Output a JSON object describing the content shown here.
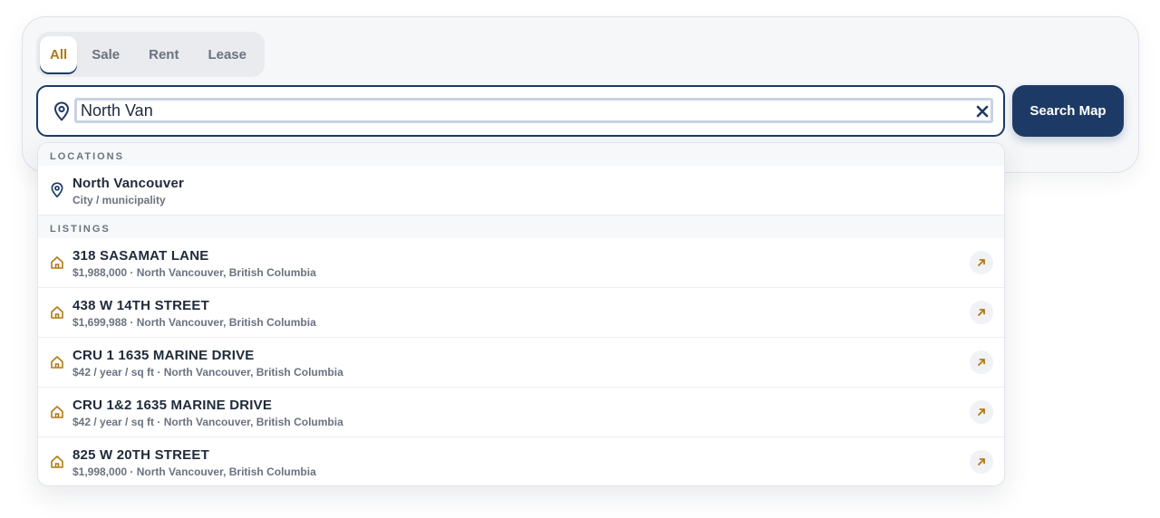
{
  "tabs": [
    {
      "label": "All",
      "active": true
    },
    {
      "label": "Sale",
      "active": false
    },
    {
      "label": "Rent",
      "active": false
    },
    {
      "label": "Lease",
      "active": false
    }
  ],
  "search": {
    "value": "North Van",
    "icon": "location-pin-icon",
    "clear_icon": "close-icon"
  },
  "search_map_button": {
    "label": "Search Map"
  },
  "dropdown": {
    "locations_header": "LOCATIONS",
    "locations": [
      {
        "title": "North Vancouver",
        "subtitle": "City / municipality",
        "icon": "location-pin-icon"
      }
    ],
    "listings_header": "LISTINGS",
    "listings": [
      {
        "title": "318 SASAMAT LANE",
        "subtitle": "$1,988,000 · North Vancouver, British Columbia",
        "icon": "home-icon"
      },
      {
        "title": "438 W 14TH STREET",
        "subtitle": "$1,699,988 · North Vancouver, British Columbia",
        "icon": "home-icon"
      },
      {
        "title": "CRU 1 1635 MARINE DRIVE",
        "subtitle": "$42 / year / sq ft · North Vancouver, British Columbia",
        "icon": "home-icon"
      },
      {
        "title": "CRU 1&2 1635 MARINE DRIVE",
        "subtitle": "$42 / year / sq ft · North Vancouver, British Columbia",
        "icon": "home-icon"
      },
      {
        "title": "825 W 20TH STREET",
        "subtitle": "$1,998,000 · North Vancouver, British Columbia",
        "icon": "home-icon"
      }
    ]
  },
  "colors": {
    "primary": "#1d3a66",
    "accent": "#b07a14",
    "muted": "#6b7280"
  }
}
